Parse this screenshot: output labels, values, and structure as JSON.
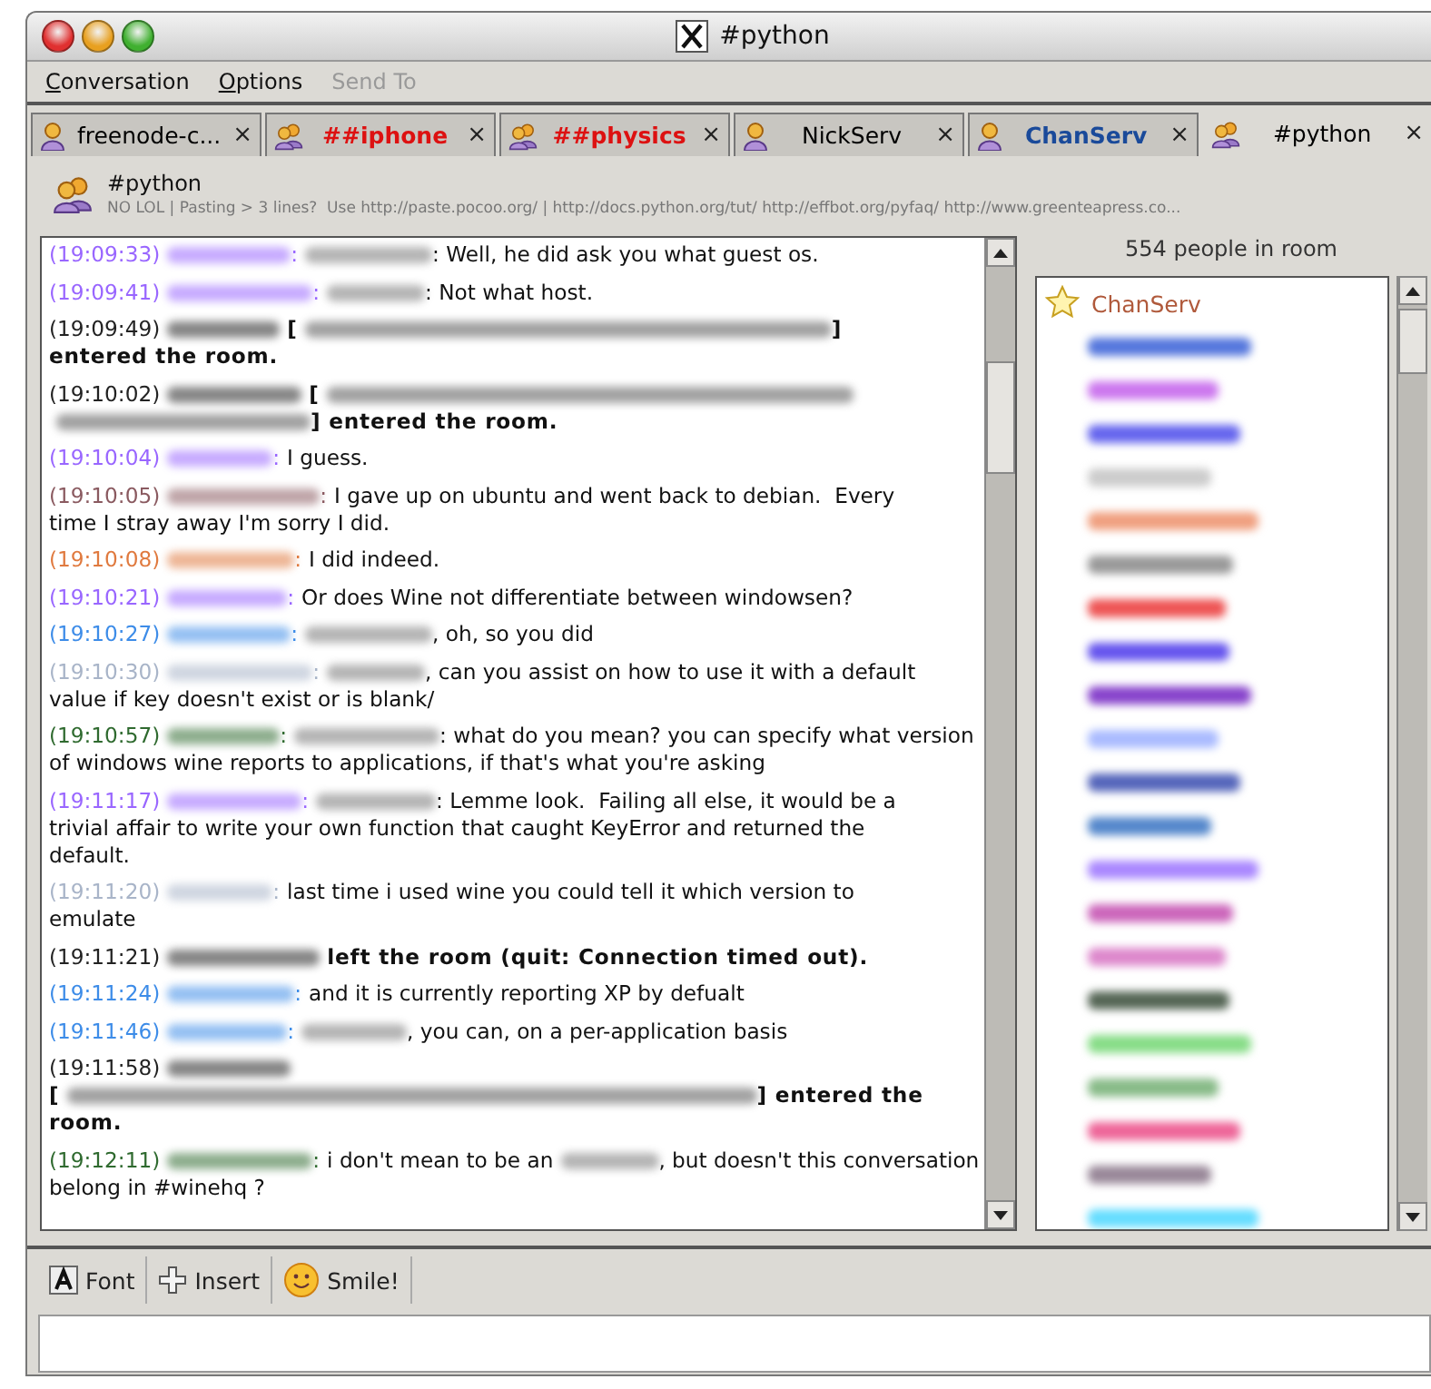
{
  "window": {
    "title": "#python"
  },
  "menu": [
    {
      "label": "Conversation",
      "disabled": false
    },
    {
      "label": "Options",
      "disabled": false
    },
    {
      "label": "Send To",
      "disabled": true
    }
  ],
  "tabs": [
    {
      "label": "freenode-c...",
      "kind": "person",
      "color": "#000000",
      "bold": false,
      "selected": false,
      "close": "×"
    },
    {
      "label": "##iphone",
      "kind": "group",
      "color": "#dd1111",
      "bold": true,
      "selected": false,
      "close": "×"
    },
    {
      "label": "##physics",
      "kind": "group",
      "color": "#dd1111",
      "bold": true,
      "selected": false,
      "close": "×"
    },
    {
      "label": "NickServ",
      "kind": "person",
      "color": "#000000",
      "bold": false,
      "selected": false,
      "close": "×"
    },
    {
      "label": "ChanServ",
      "kind": "person",
      "color": "#1a4a9a",
      "bold": true,
      "selected": false,
      "close": "×"
    },
    {
      "label": "#python",
      "kind": "group",
      "color": "#000000",
      "bold": false,
      "selected": true,
      "close": "×"
    }
  ],
  "header": {
    "name": "#python",
    "topic": "NO LOL | Pasting > 3 lines?  Use http://paste.pocoo.org/ | http://docs.python.org/tut/ http://effbot.org/pyfaq/ http://www.greenteapress.co..."
  },
  "messages": [
    {
      "color": "#9966ff",
      "lines": [
        [
          {
            "kind": "stamp",
            "text": "(19:09:33)"
          },
          {
            "kind": "nick"
          },
          {
            "kind": "sep",
            "text": ":"
          },
          {
            "kind": "blur"
          },
          {
            "kind": "tail",
            "text": ": Well, he did ask you what guest os."
          }
        ]
      ]
    },
    {
      "color": "#9966ff",
      "lines": [
        [
          {
            "kind": "stamp",
            "text": "(19:09:41)"
          },
          {
            "kind": "nick"
          },
          {
            "kind": "sep",
            "text": ":"
          },
          {
            "kind": "blur"
          },
          {
            "kind": "tail",
            "text": ": Not what host."
          }
        ]
      ]
    },
    {
      "color": "#222222",
      "lines": [
        [
          {
            "kind": "stamp",
            "text": "(19:09:49)"
          },
          {
            "kind": "nick"
          },
          {
            "kind": "bold",
            "text": "["
          },
          {
            "kind": "host"
          },
          {
            "kind": "boldtail",
            "text": "]"
          }
        ],
        [
          {
            "kind": "boldtail",
            "text": "entered the room."
          }
        ]
      ]
    },
    {
      "color": "#222222",
      "lines": [
        [
          {
            "kind": "stamp",
            "text": "(19:10:02)"
          },
          {
            "kind": "nick"
          },
          {
            "kind": "bold",
            "text": "["
          },
          {
            "kind": "host"
          }
        ],
        [
          {
            "kind": "hostend"
          },
          {
            "kind": "boldtail",
            "text": "] entered the room."
          }
        ]
      ]
    },
    {
      "color": "#9966ff",
      "lines": [
        [
          {
            "kind": "stamp",
            "text": "(19:10:04)"
          },
          {
            "kind": "nick"
          },
          {
            "kind": "sep",
            "text": ":"
          },
          {
            "kind": "text",
            "text": "I guess."
          }
        ]
      ]
    },
    {
      "color": "#8a5a60",
      "lines": [
        [
          {
            "kind": "stamp",
            "text": "(19:10:05)"
          },
          {
            "kind": "nick"
          },
          {
            "kind": "sep",
            "text": ":"
          },
          {
            "kind": "text",
            "text": "I gave up on ubuntu and went back to debian.  Every"
          }
        ],
        [
          {
            "kind": "tail",
            "text": "time I stray away I'm sorry I did."
          }
        ]
      ]
    },
    {
      "color": "#e07a3f",
      "lines": [
        [
          {
            "kind": "stamp",
            "text": "(19:10:08)"
          },
          {
            "kind": "nick"
          },
          {
            "kind": "sep",
            "text": ":"
          },
          {
            "kind": "text",
            "text": "I did indeed."
          }
        ]
      ]
    },
    {
      "color": "#9966ff",
      "lines": [
        [
          {
            "kind": "stamp",
            "text": "(19:10:21)"
          },
          {
            "kind": "nick"
          },
          {
            "kind": "sep",
            "text": ":"
          },
          {
            "kind": "text",
            "text": "Or does Wine not differentiate between windowsen?"
          }
        ]
      ]
    },
    {
      "color": "#3d8ce8",
      "lines": [
        [
          {
            "kind": "stamp",
            "text": "(19:10:27)"
          },
          {
            "kind": "nick"
          },
          {
            "kind": "sep",
            "text": ":"
          },
          {
            "kind": "blur"
          },
          {
            "kind": "tail",
            "text": ", oh, so you did"
          }
        ]
      ]
    },
    {
      "color": "#a8b4c8",
      "lines": [
        [
          {
            "kind": "stamp",
            "text": "(19:10:30)"
          },
          {
            "kind": "nick"
          },
          {
            "kind": "sep",
            "text": ":"
          },
          {
            "kind": "blur"
          },
          {
            "kind": "tail",
            "text": ", can you assist on how to use it with a default"
          }
        ],
        [
          {
            "kind": "tail",
            "text": "value if key doesn't exist or is blank/"
          }
        ]
      ]
    },
    {
      "color": "#2f6a2f",
      "lines": [
        [
          {
            "kind": "stamp",
            "text": "(19:10:57)"
          },
          {
            "kind": "nick"
          },
          {
            "kind": "sep",
            "text": ":"
          },
          {
            "kind": "blur"
          },
          {
            "kind": "tail",
            "text": ": what do you mean? you can specify what version"
          }
        ],
        [
          {
            "kind": "tail",
            "text": "of windows wine reports to applications, if that's what you're asking"
          }
        ]
      ]
    },
    {
      "color": "#9966ff",
      "lines": [
        [
          {
            "kind": "stamp",
            "text": "(19:11:17)"
          },
          {
            "kind": "nick"
          },
          {
            "kind": "sep",
            "text": ":"
          },
          {
            "kind": "blur"
          },
          {
            "kind": "tail",
            "text": ": Lemme look.  Failing all else, it would be a"
          }
        ],
        [
          {
            "kind": "tail",
            "text": "trivial affair to write your own function that caught KeyError and returned the"
          }
        ],
        [
          {
            "kind": "tail",
            "text": "default."
          }
        ]
      ]
    },
    {
      "color": "#a8b4c8",
      "lines": [
        [
          {
            "kind": "stamp",
            "text": "(19:11:20)"
          },
          {
            "kind": "nick"
          },
          {
            "kind": "sep",
            "text": ":"
          },
          {
            "kind": "text",
            "text": "last time i used wine you could tell it which version to"
          }
        ],
        [
          {
            "kind": "tail",
            "text": "emulate"
          }
        ]
      ]
    },
    {
      "color": "#222222",
      "lines": [
        [
          {
            "kind": "stamp",
            "text": "(19:11:21)"
          },
          {
            "kind": "nick"
          },
          {
            "kind": "bold",
            "text": "left the room (quit: Connection timed out)."
          }
        ]
      ]
    },
    {
      "color": "#3d8ce8",
      "lines": [
        [
          {
            "kind": "stamp",
            "text": "(19:11:24)"
          },
          {
            "kind": "nick"
          },
          {
            "kind": "sep",
            "text": ":"
          },
          {
            "kind": "text",
            "text": "and it is currently reporting XP by defualt"
          }
        ]
      ]
    },
    {
      "color": "#3d8ce8",
      "lines": [
        [
          {
            "kind": "stamp",
            "text": "(19:11:46)"
          },
          {
            "kind": "nick"
          },
          {
            "kind": "sep",
            "text": ":"
          },
          {
            "kind": "blur"
          },
          {
            "kind": "tail",
            "text": ", you can, on a per-application basis"
          }
        ]
      ]
    },
    {
      "color": "#222222",
      "lines": [
        [
          {
            "kind": "stamp",
            "text": "(19:11:58)"
          },
          {
            "kind": "nick"
          }
        ],
        [
          {
            "kind": "boldtail",
            "text": "["
          },
          {
            "kind": "hostlong"
          },
          {
            "kind": "boldtail",
            "text": "] entered the"
          }
        ],
        [
          {
            "kind": "boldtail",
            "text": "room."
          }
        ]
      ]
    },
    {
      "color": "#2f6a2f",
      "lines": [
        [
          {
            "kind": "stamp",
            "text": "(19:12:11)"
          },
          {
            "kind": "nick"
          },
          {
            "kind": "sep",
            "text": ":"
          },
          {
            "kind": "text",
            "text": "i don't mean to be an"
          },
          {
            "kind": "blur"
          },
          {
            "kind": "tail",
            "text": ", but doesn't this conversation"
          }
        ],
        [
          {
            "kind": "tail",
            "text": "belong in #winehq ?"
          }
        ]
      ]
    }
  ],
  "people": {
    "count": "554 people in room",
    "list": [
      {
        "kind": "op",
        "text": "ChanServ",
        "color": "#b05a3c"
      },
      {
        "kind": "blur",
        "color": "#5577dd"
      },
      {
        "kind": "blur",
        "color": "#cc77ee"
      },
      {
        "kind": "blur",
        "color": "#6666ee"
      },
      {
        "kind": "blur",
        "color": "#cccccc"
      },
      {
        "kind": "blur",
        "color": "#f0a080"
      },
      {
        "kind": "blur",
        "color": "#999999"
      },
      {
        "kind": "blur",
        "color": "#ee5555"
      },
      {
        "kind": "blur",
        "color": "#6655ee"
      },
      {
        "kind": "blur",
        "color": "#8844cc"
      },
      {
        "kind": "blur",
        "color": "#aabbff"
      },
      {
        "kind": "blur",
        "color": "#5566bb"
      },
      {
        "kind": "blur",
        "color": "#5588cc"
      },
      {
        "kind": "blur",
        "color": "#aa88ff"
      },
      {
        "kind": "blur",
        "color": "#cc66bb"
      },
      {
        "kind": "blur",
        "color": "#dd88cc"
      },
      {
        "kind": "blur",
        "color": "#556655"
      },
      {
        "kind": "blur",
        "color": "#88dd88"
      },
      {
        "kind": "blur",
        "color": "#88bb88"
      },
      {
        "kind": "blur",
        "color": "#ee6699"
      },
      {
        "kind": "blur",
        "color": "#998899"
      },
      {
        "kind": "blur",
        "color": "#66ddff"
      }
    ]
  },
  "toolbar": [
    {
      "kind": "font",
      "label": "Font"
    },
    {
      "kind": "insert",
      "label": "Insert"
    },
    {
      "kind": "smile",
      "label": "Smile!"
    }
  ]
}
